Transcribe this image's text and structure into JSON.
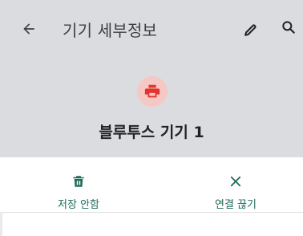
{
  "app_bar": {
    "title": "기기 세부정보",
    "back_icon": "arrow-back-icon",
    "edit_icon": "pencil-icon",
    "search_icon": "search-icon"
  },
  "device": {
    "name": "블루투스 기기 1",
    "icon": "printer-icon",
    "icon_color": "#e3342f",
    "avatar_bg": "#f6c8c4"
  },
  "actions": {
    "forget": {
      "label": "저장 안함",
      "icon": "trash-icon"
    },
    "disconnect": {
      "label": "연결 끊기",
      "icon": "close-icon"
    }
  },
  "colors": {
    "header_bg": "#dadce0",
    "accent": "#1e6b5a"
  }
}
